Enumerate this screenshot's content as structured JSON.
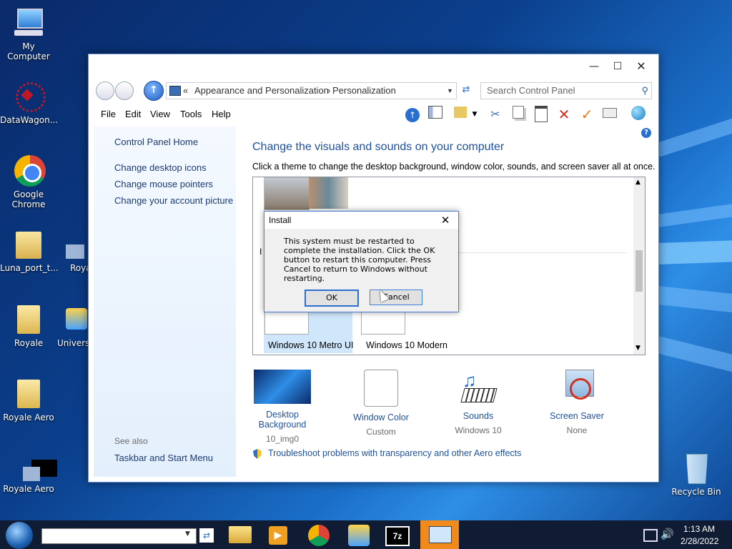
{
  "desktop": {
    "icons": [
      {
        "label": "My Computer"
      },
      {
        "label": "DataWagon..."
      },
      {
        "label": "Google Chrome"
      },
      {
        "label": "Luna_port_t..."
      },
      {
        "label": "Roya"
      },
      {
        "label": "Royale"
      },
      {
        "label": "Univers"
      },
      {
        "label": "Royale Aero"
      },
      {
        "label": "Royale Aero"
      },
      {
        "label": "Recycle Bin"
      }
    ]
  },
  "window": {
    "address": {
      "sep": "«",
      "crumb1": "Appearance and Personalization",
      "arrow": "›",
      "crumb2": "Personalization"
    },
    "search_placeholder": "Search Control Panel",
    "menu": [
      "File",
      "Edit",
      "View",
      "Tools",
      "Help"
    ],
    "left_pane": {
      "home": "Control Panel Home",
      "links": [
        "Change desktop icons",
        "Change mouse pointers",
        "Change your account picture"
      ],
      "see_also": "See also",
      "see_also_link": "Taskbar and Start Menu"
    },
    "heading": "Change the visuals and sounds on your computer",
    "subtext": "Click a theme to change the desktop background, window color, sounds, and screen saver all at once.",
    "themes": [
      {
        "name": "Windows 10 Metro UI"
      },
      {
        "name": "Windows 10 Modern"
      }
    ],
    "partial_char": "I",
    "bottom_items": [
      {
        "label": "Desktop Background",
        "sub": "10_img0"
      },
      {
        "label": "Window Color",
        "sub": "Custom"
      },
      {
        "label": "Sounds",
        "sub": "Windows 10"
      },
      {
        "label": "Screen Saver",
        "sub": "None"
      }
    ],
    "troubleshoot": "Troubleshoot problems with transparency and other Aero effects"
  },
  "dialog": {
    "title": "Install",
    "message": "This system must be restarted to complete the installation. Click the OK button to restart this computer. Press Cancel to return to Windows without restarting.",
    "ok": "OK",
    "cancel": "Cancel"
  },
  "taskbar": {
    "time": "1:13 AM",
    "date": "2/28/2022"
  },
  "colors": {
    "link": "#1e4f9c",
    "accent": "#3c7fd8",
    "taskbar": "#101c33"
  }
}
